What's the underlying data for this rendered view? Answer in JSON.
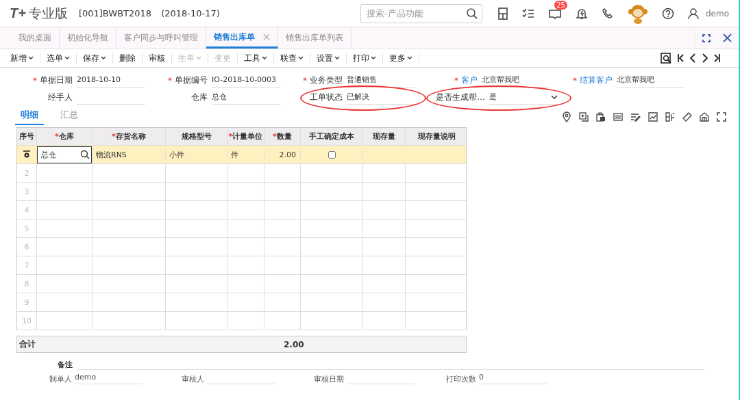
{
  "header": {
    "logo_mark": "T+",
    "logo_text": "专业版",
    "account": "[001]BWBT2018",
    "date": "(2018-10-17)",
    "search": {
      "placeholder": "搜索-产品功能"
    },
    "notification_count": "25",
    "user": "demo"
  },
  "tabs": [
    {
      "label": "我的桌面",
      "selected": false,
      "closable": false
    },
    {
      "label": "初始化导航",
      "selected": false,
      "closable": false
    },
    {
      "label": "客户同步与呼叫管理",
      "selected": false,
      "closable": false
    },
    {
      "label": "销售出库单",
      "selected": true,
      "closable": true
    },
    {
      "label": "销售出库单列表",
      "selected": false,
      "closable": false
    }
  ],
  "toolbar": [
    {
      "label": "新增",
      "dropdown": true,
      "disabled": false
    },
    {
      "label": "选单",
      "dropdown": true,
      "disabled": false
    },
    {
      "label": "保存",
      "dropdown": true,
      "disabled": false
    },
    {
      "label": "删除",
      "dropdown": false,
      "disabled": false
    },
    {
      "label": "审核",
      "dropdown": false,
      "disabled": false
    },
    {
      "label": "生单",
      "dropdown": true,
      "disabled": true
    },
    {
      "label": "变更",
      "dropdown": false,
      "disabled": true
    },
    {
      "label": "工具",
      "dropdown": true,
      "disabled": false
    },
    {
      "label": "联查",
      "dropdown": true,
      "disabled": false
    },
    {
      "label": "设置",
      "dropdown": true,
      "disabled": false
    },
    {
      "label": "打印",
      "dropdown": true,
      "disabled": false
    },
    {
      "label": "更多",
      "dropdown": true,
      "disabled": false
    }
  ],
  "form_rows": [
    [
      {
        "required_mark": "*",
        "label": "单据日期",
        "value": "2018-10-10",
        "link": false,
        "kind": "text",
        "circled": false
      },
      {
        "required_mark": "*",
        "label": "单据编号",
        "value": "IO-2018-10-0003",
        "link": false,
        "kind": "text",
        "circled": false
      },
      {
        "required_mark": "*",
        "label": "业务类型",
        "value": "普通销售",
        "link": false,
        "kind": "text",
        "circled": false
      },
      {
        "required_mark": "*",
        "label": "客户",
        "value": "北京帮我吧",
        "link": true,
        "kind": "text",
        "circled": false
      },
      {
        "required_mark": "*",
        "label": "结算客户",
        "value": "北京帮我吧",
        "link": true,
        "kind": "text",
        "circled": false
      }
    ],
    [
      {
        "label": "经手人",
        "link": false,
        "kind": "text",
        "circled": false
      },
      {
        "label": "仓库",
        "value": "总仓",
        "link": false,
        "kind": "text",
        "circled": false
      },
      {
        "label": "工单状态",
        "value": "已解决",
        "link": false,
        "kind": "text",
        "circled": true
      },
      {
        "label": "是否生成帮…",
        "value": "是",
        "link": false,
        "kind": "select",
        "circled": true
      }
    ]
  ],
  "subtabs": [
    {
      "label": "明细",
      "selected": true
    },
    {
      "label": "汇总",
      "selected": false
    }
  ],
  "table": {
    "columns": [
      {
        "label": "序号"
      },
      {
        "required_mark": "*",
        "label": "仓库"
      },
      {
        "required_mark": "*",
        "label": "存货名称"
      },
      {
        "label": "规格型号"
      },
      {
        "required_mark": "*",
        "label": "计量单位"
      },
      {
        "required_mark": "*",
        "label": "数量"
      },
      {
        "label": "手工确定成本"
      },
      {
        "label": "现存量"
      },
      {
        "label": "现存量说明"
      }
    ],
    "rows": [
      {
        "selected": true,
        "warehouse": "总仓",
        "item": "物流RNS",
        "spec": "小件",
        "unit": "件",
        "quantity": "2.00",
        "manual_cost": false
      }
    ],
    "empty_rows": [
      "2",
      "3",
      "4",
      "5",
      "6",
      "7",
      "8",
      "9",
      "10"
    ],
    "total": {
      "label": "合计",
      "quantity": "2.00"
    }
  },
  "remark": {
    "label": "备注"
  },
  "footer": [
    {
      "label": "制单人",
      "value": "demo"
    },
    {
      "label": "审核人"
    },
    {
      "label": "审核日期"
    },
    {
      "label": "打印次数",
      "value": "0"
    }
  ]
}
